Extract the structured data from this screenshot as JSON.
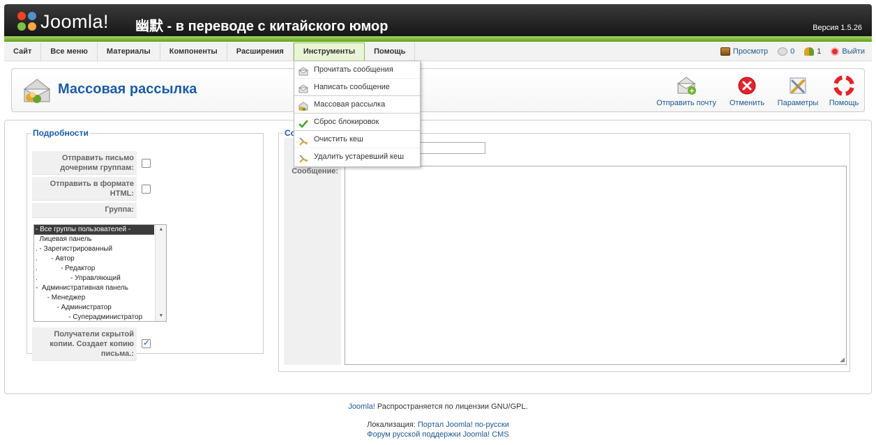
{
  "header": {
    "logo_text": "Joomla!",
    "site_title": "幽默 - в переводе с китайского юмор",
    "version": "Версия 1.5.26"
  },
  "menu": {
    "items": [
      {
        "label": "Сайт"
      },
      {
        "label": "Все меню"
      },
      {
        "label": "Материалы"
      },
      {
        "label": "Компоненты"
      },
      {
        "label": "Расширения"
      },
      {
        "label": "Инструменты",
        "active": true
      },
      {
        "label": "Помощь"
      }
    ],
    "status": {
      "preview": "Просмотр",
      "messages_count": "0",
      "users_count": "1",
      "logout": "Выйти"
    }
  },
  "dropdown": {
    "items": [
      {
        "label": "Прочитать сообщения",
        "icon": "envelope-icon"
      },
      {
        "label": "Написать сообщение",
        "icon": "envelope-write-icon"
      },
      {
        "label": "Массовая рассылка",
        "icon": "mass-mail-icon"
      },
      {
        "label": "Сброс блокировок",
        "icon": "checkmark-icon"
      },
      {
        "label": "Очистить кеш",
        "icon": "broom-icon"
      },
      {
        "label": "Удалить устаревший кеш",
        "icon": "broom-icon"
      }
    ]
  },
  "toolbar": {
    "page_title": "Массовая рассылка",
    "buttons": [
      {
        "label": "Отправить почту",
        "icon": "send-mail-icon"
      },
      {
        "label": "Отменить",
        "icon": "cancel-icon"
      },
      {
        "label": "Параметры",
        "icon": "settings-icon"
      },
      {
        "label": "Помощь",
        "icon": "help-lifebuoy-icon"
      }
    ]
  },
  "details": {
    "legend": "Подробности",
    "send_to_children_label": "Отправить письмо дочерним группам:",
    "send_to_children_checked": false,
    "html_format_label": "Отправить в формате HTML:",
    "html_format_checked": false,
    "group_label": "Группа:",
    "groups": [
      "- Все группы пользователей -",
      "  Лицевая панель",
      ". - Зарегистрированный",
      ".       - Автор",
      ".            - Редактор",
      ".                 - Управляющий",
      "-  Административная панель",
      "      - Менеджер",
      "           - Администратор",
      "                 - Суперадминистратор"
    ],
    "selected_group_index": 0,
    "bcc_label": "Получатели скрытой копии. Создает копию письма.:",
    "bcc_checked": true
  },
  "message": {
    "legend": "Сообщение",
    "subject_value": "",
    "message_label": "Сообщение:",
    "message_value": ""
  },
  "footer": {
    "joomla_link": "Joomla!",
    "license_text": " Распространяется по лицензии GNU/GPL.",
    "localization_label": "Локализация: ",
    "localization_link": "Портал Joomla! по-русски",
    "forum_link": "Форум русской поддержки Joomla! CMS"
  }
}
